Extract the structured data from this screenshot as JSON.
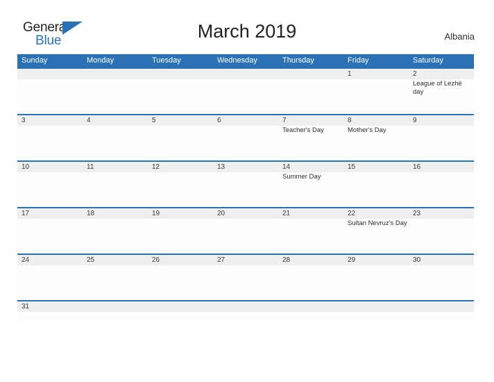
{
  "brand": {
    "name_part1": "General",
    "name_part2": "Blue",
    "flag_icon": "triangle-flag-icon",
    "accent_color": "#2a72b5"
  },
  "header": {
    "title": "March 2019",
    "country": "Albania"
  },
  "calendar": {
    "weekday_headers": [
      "Sunday",
      "Monday",
      "Tuesday",
      "Wednesday",
      "Thursday",
      "Friday",
      "Saturday"
    ],
    "header_bg": "#2a72b5",
    "band_bg": "#efefef",
    "cell_bg": "#fdfdfd",
    "weeks": [
      {
        "days": [
          {
            "date": "",
            "event": ""
          },
          {
            "date": "",
            "event": ""
          },
          {
            "date": "",
            "event": ""
          },
          {
            "date": "",
            "event": ""
          },
          {
            "date": "",
            "event": ""
          },
          {
            "date": "1",
            "event": ""
          },
          {
            "date": "2",
            "event": "League of Lezhë day"
          }
        ]
      },
      {
        "days": [
          {
            "date": "3",
            "event": ""
          },
          {
            "date": "4",
            "event": ""
          },
          {
            "date": "5",
            "event": ""
          },
          {
            "date": "6",
            "event": ""
          },
          {
            "date": "7",
            "event": "Teacher's Day"
          },
          {
            "date": "8",
            "event": "Mother's Day"
          },
          {
            "date": "9",
            "event": ""
          }
        ]
      },
      {
        "days": [
          {
            "date": "10",
            "event": ""
          },
          {
            "date": "11",
            "event": ""
          },
          {
            "date": "12",
            "event": ""
          },
          {
            "date": "13",
            "event": ""
          },
          {
            "date": "14",
            "event": "Summer Day"
          },
          {
            "date": "15",
            "event": ""
          },
          {
            "date": "16",
            "event": ""
          }
        ]
      },
      {
        "days": [
          {
            "date": "17",
            "event": ""
          },
          {
            "date": "18",
            "event": ""
          },
          {
            "date": "19",
            "event": ""
          },
          {
            "date": "20",
            "event": ""
          },
          {
            "date": "21",
            "event": ""
          },
          {
            "date": "22",
            "event": "Sultan Nevruz's Day"
          },
          {
            "date": "23",
            "event": ""
          }
        ]
      },
      {
        "days": [
          {
            "date": "24",
            "event": ""
          },
          {
            "date": "25",
            "event": ""
          },
          {
            "date": "26",
            "event": ""
          },
          {
            "date": "27",
            "event": ""
          },
          {
            "date": "28",
            "event": ""
          },
          {
            "date": "29",
            "event": ""
          },
          {
            "date": "30",
            "event": ""
          }
        ]
      },
      {
        "days": [
          {
            "date": "31",
            "event": ""
          },
          {
            "date": "",
            "event": ""
          },
          {
            "date": "",
            "event": ""
          },
          {
            "date": "",
            "event": ""
          },
          {
            "date": "",
            "event": ""
          },
          {
            "date": "",
            "event": ""
          },
          {
            "date": "",
            "event": ""
          }
        ]
      }
    ]
  }
}
